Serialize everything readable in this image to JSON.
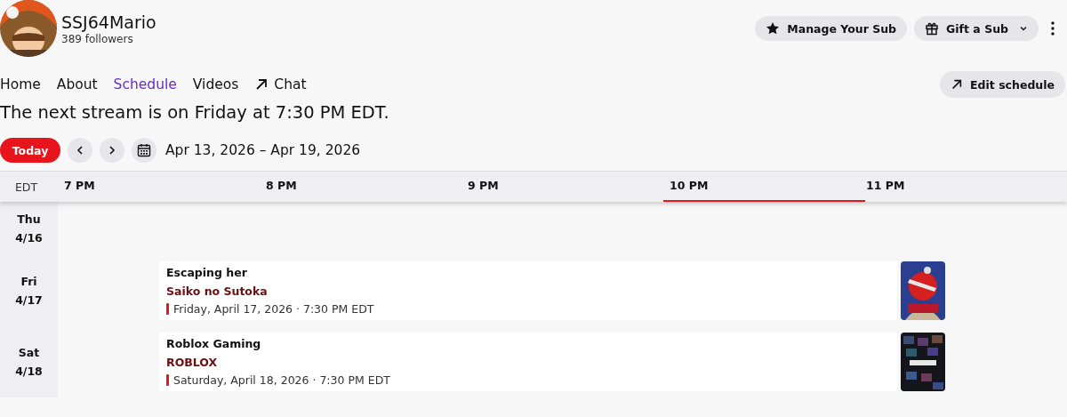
{
  "channel": {
    "name": "SSJ64Mario",
    "followers": "389 followers"
  },
  "actions": [
    {
      "kind": "star",
      "label": "Manage Your Sub"
    },
    {
      "kind": "gift",
      "label": "Gift a Sub"
    }
  ],
  "nav": [
    {
      "label": "Home",
      "selected": false,
      "external": false
    },
    {
      "label": "About",
      "selected": false,
      "external": false
    },
    {
      "label": "Schedule",
      "selected": true,
      "external": false
    },
    {
      "label": "Videos",
      "selected": false,
      "external": false
    },
    {
      "label": "Chat",
      "selected": false,
      "external": true
    }
  ],
  "edit_button": "Edit schedule",
  "next_stream": "The next stream is on Friday at 7:30 PM EDT.",
  "controls": {
    "today": "Today",
    "range": "Apr 13, 2026 – Apr 19, 2026"
  },
  "timeline": {
    "timezone": "EDT",
    "hours": [
      {
        "label": "7 PM",
        "current": false
      },
      {
        "label": "8 PM",
        "current": false
      },
      {
        "label": "9 PM",
        "current": false
      },
      {
        "label": "10 PM",
        "current": true
      },
      {
        "label": "11 PM",
        "current": false
      }
    ],
    "days": [
      {
        "weekday": "Thu",
        "date": "4/16"
      },
      {
        "weekday": "Fri",
        "date": "4/17",
        "events": [
          {
            "title": "Escaping her",
            "game": "Saiko no Sutoka",
            "when": "Friday, April 17, 2026 · 7:30 PM EDT"
          }
        ]
      },
      {
        "weekday": "Sat",
        "date": "4/18",
        "events": [
          {
            "title": "Roblox Gaming",
            "game": "ROBLOX",
            "when": "Saturday, April 18, 2026 · 7:30 PM EDT"
          }
        ]
      }
    ]
  }
}
